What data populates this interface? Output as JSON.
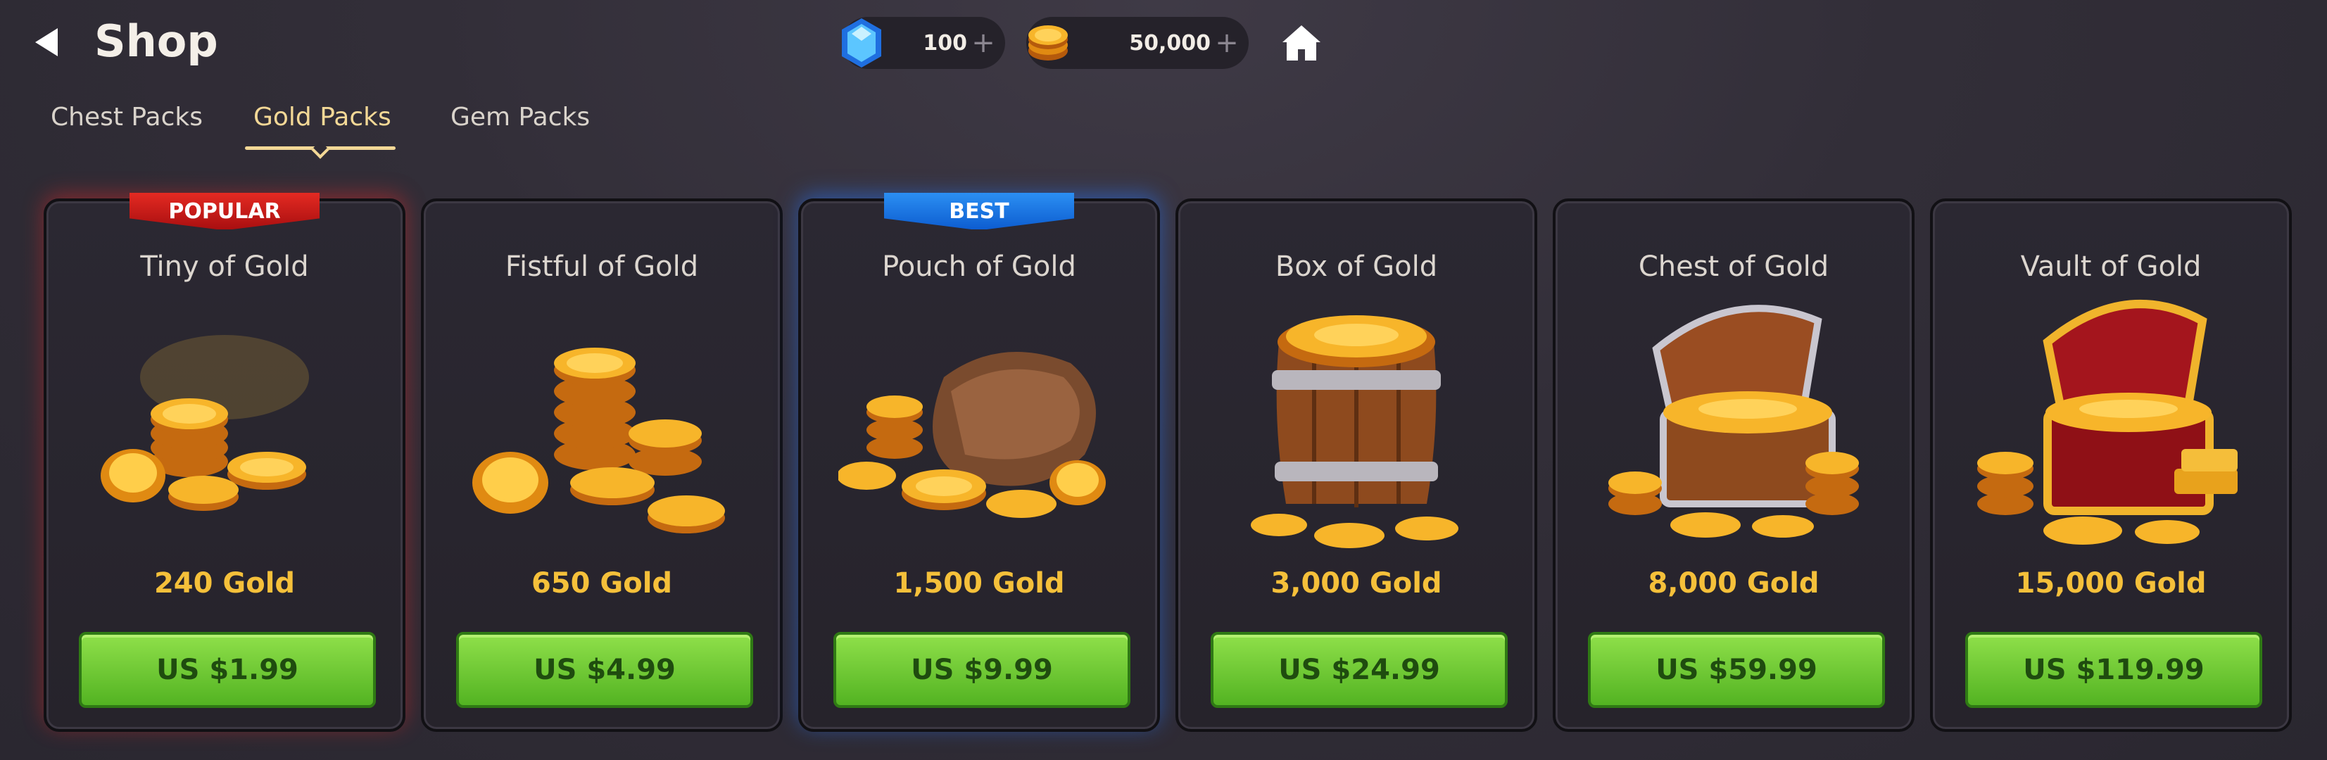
{
  "header": {
    "title": "Shop",
    "resources": [
      {
        "name": "gems",
        "value": "100"
      },
      {
        "name": "gold",
        "value": "50,000"
      }
    ],
    "plus": "+"
  },
  "tabs": [
    {
      "label": "Chest Packs",
      "active": false
    },
    {
      "label": "Gold Packs",
      "active": true
    },
    {
      "label": "Gem Packs",
      "active": false
    }
  ],
  "packs": [
    {
      "name": "Tiny of Gold",
      "amount": "240 Gold",
      "price": "US $1.99",
      "badge": "POPULAR",
      "badge_color": "#c7191a",
      "art": "small-coin-stack"
    },
    {
      "name": "Fistful of Gold",
      "amount": "650 Gold",
      "price": "US $4.99",
      "badge": "",
      "art": "coin-stacks"
    },
    {
      "name": "Pouch of Gold",
      "amount": "1,500 Gold",
      "price": "US $9.99",
      "badge": "BEST",
      "badge_color": "#1c7be6",
      "art": "coin-pouch"
    },
    {
      "name": "Box of Gold",
      "amount": "3,000 Gold",
      "price": "US $24.99",
      "badge": "",
      "art": "gold-barrel"
    },
    {
      "name": "Chest of Gold",
      "amount": "8,000 Gold",
      "price": "US $59.99",
      "badge": "",
      "art": "gold-chest"
    },
    {
      "name": "Vault of Gold",
      "amount": "15,000 Gold",
      "price": "US $119.99",
      "badge": "",
      "art": "gold-vault-chest"
    }
  ],
  "colors": {
    "accent_gold": "#f5c03a",
    "tab_active": "#f3d896",
    "buy_button": "#6fcf2f",
    "background": "#322e38"
  }
}
